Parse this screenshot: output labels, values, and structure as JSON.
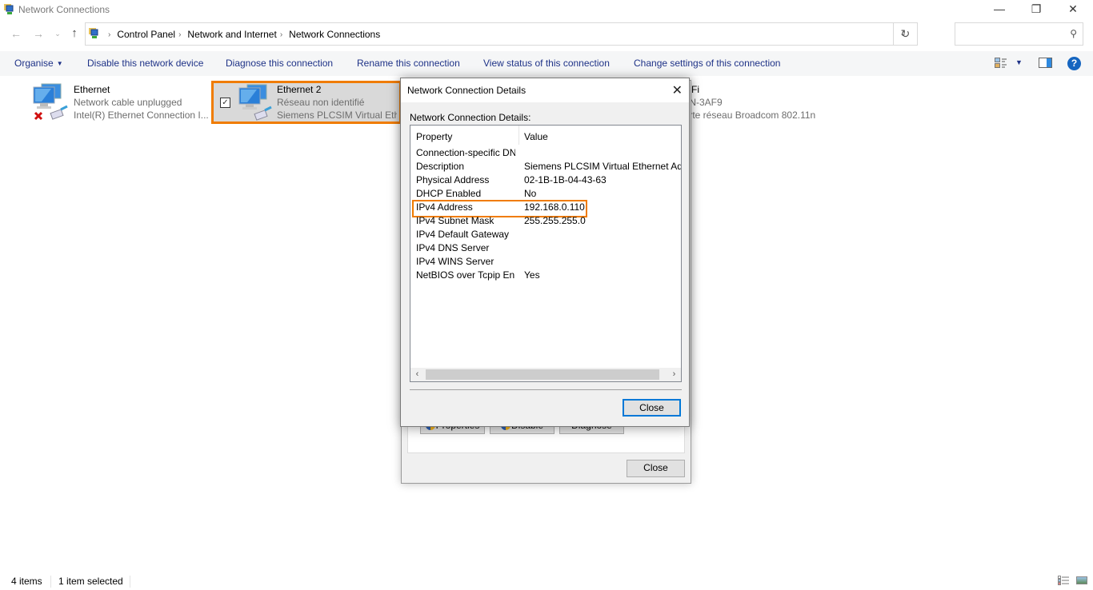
{
  "window": {
    "title": "Network Connections",
    "app_icon": "network-connections-icon",
    "controls": {
      "minimize": "—",
      "maximize": "❐",
      "close": "✕"
    }
  },
  "navigation": {
    "back": "←",
    "forward": "→",
    "recent": "⌄",
    "up": "↑",
    "breadcrumb": [
      "Control Panel",
      "Network and Internet",
      "Network Connections"
    ],
    "breadcrumb_separator": "›",
    "dropdown": "⌄",
    "refresh": "↻",
    "search_value": "",
    "search_placeholder": "",
    "search_icon": "⚲"
  },
  "commandbar": {
    "organise": "Organise",
    "organise_caret": "▼",
    "commands": [
      "Disable this network device",
      "Diagnose this connection",
      "Rename this connection",
      "View status of this connection",
      "Change settings of this connection"
    ],
    "view_caret": "▼",
    "help": "?"
  },
  "items": [
    {
      "name": "Ethernet",
      "status": "Network cable unplugged",
      "adapter": "Intel(R) Ethernet Connection I...",
      "icon": "network-disconnected-icon",
      "selected": false
    },
    {
      "name": "Ethernet 2",
      "status": "Réseau non identifié",
      "adapter": "Siemens PLCSIM Virtual Ethernet Adapter",
      "icon": "network-adapter-icon",
      "selected": true,
      "checked": "✓"
    },
    {
      "name": "Wi-Fi",
      "status": "LHN-3AF9",
      "adapter": "Carte réseau Broadcom 802.11n",
      "icon": "wifi-adapter-icon",
      "selected": false
    }
  ],
  "statusbar": {
    "count": "4 items",
    "selection": "1 item selected"
  },
  "status_dialog": {
    "buttons": {
      "properties": "Properties",
      "disable": "Disable",
      "diagnose": "Diagnose",
      "close": "Close"
    }
  },
  "details_dialog": {
    "title": "Network Connection Details",
    "label": "Network Connection Details:",
    "columns": {
      "property": "Property",
      "value": "Value"
    },
    "rows": [
      {
        "property": "Connection-specific DN...",
        "value": ""
      },
      {
        "property": "Description",
        "value": "Siemens PLCSIM Virtual Ethernet Adapter"
      },
      {
        "property": "Physical Address",
        "value": "02-1B-1B-04-43-63"
      },
      {
        "property": "DHCP Enabled",
        "value": "No"
      },
      {
        "property": "IPv4 Address",
        "value": "192.168.0.110",
        "highlighted": true
      },
      {
        "property": "IPv4 Subnet Mask",
        "value": "255.255.255.0"
      },
      {
        "property": "IPv4 Default Gateway",
        "value": ""
      },
      {
        "property": "IPv4 DNS Server",
        "value": ""
      },
      {
        "property": "IPv4 WINS Server",
        "value": ""
      },
      {
        "property": "NetBIOS over Tcpip En...",
        "value": "Yes"
      }
    ],
    "scroll_left": "‹",
    "scroll_right": "›",
    "close_x": "✕",
    "close_button": "Close"
  },
  "colors": {
    "highlight": "#f07c00",
    "command_text": "#1e3287",
    "focus_border": "#0078d7",
    "selection_bg": "#d9d9d9"
  }
}
